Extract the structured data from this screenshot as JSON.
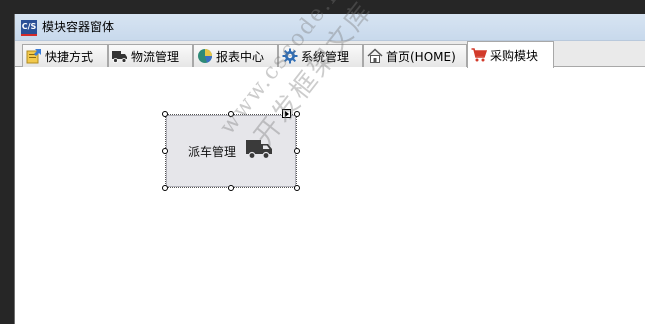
{
  "window": {
    "app_icon_text": "C/S",
    "title": "模块容器窗体"
  },
  "tabs": [
    {
      "label": "快捷方式",
      "icon": "shortcut-icon",
      "active": false
    },
    {
      "label": "物流管理",
      "icon": "truck-icon",
      "active": false
    },
    {
      "label": "报表中心",
      "icon": "pie-chart-icon",
      "active": false
    },
    {
      "label": "系统管理",
      "icon": "gear-icon",
      "active": false
    },
    {
      "label": "首页(HOME)",
      "icon": "home-icon",
      "active": false
    },
    {
      "label": "采购模块",
      "icon": "shopping-cart-icon",
      "active": true
    }
  ],
  "module": {
    "label": "派车管理",
    "icon": "truck-icon"
  },
  "watermark": {
    "line1": "www.cscode.net",
    "line2": "开发框架文库"
  },
  "colors": {
    "titlebar": "#c8d9ec",
    "tile_bg": "#e6e6ea",
    "app_icon": "#2a4f96",
    "cart": "#d23a2a"
  }
}
